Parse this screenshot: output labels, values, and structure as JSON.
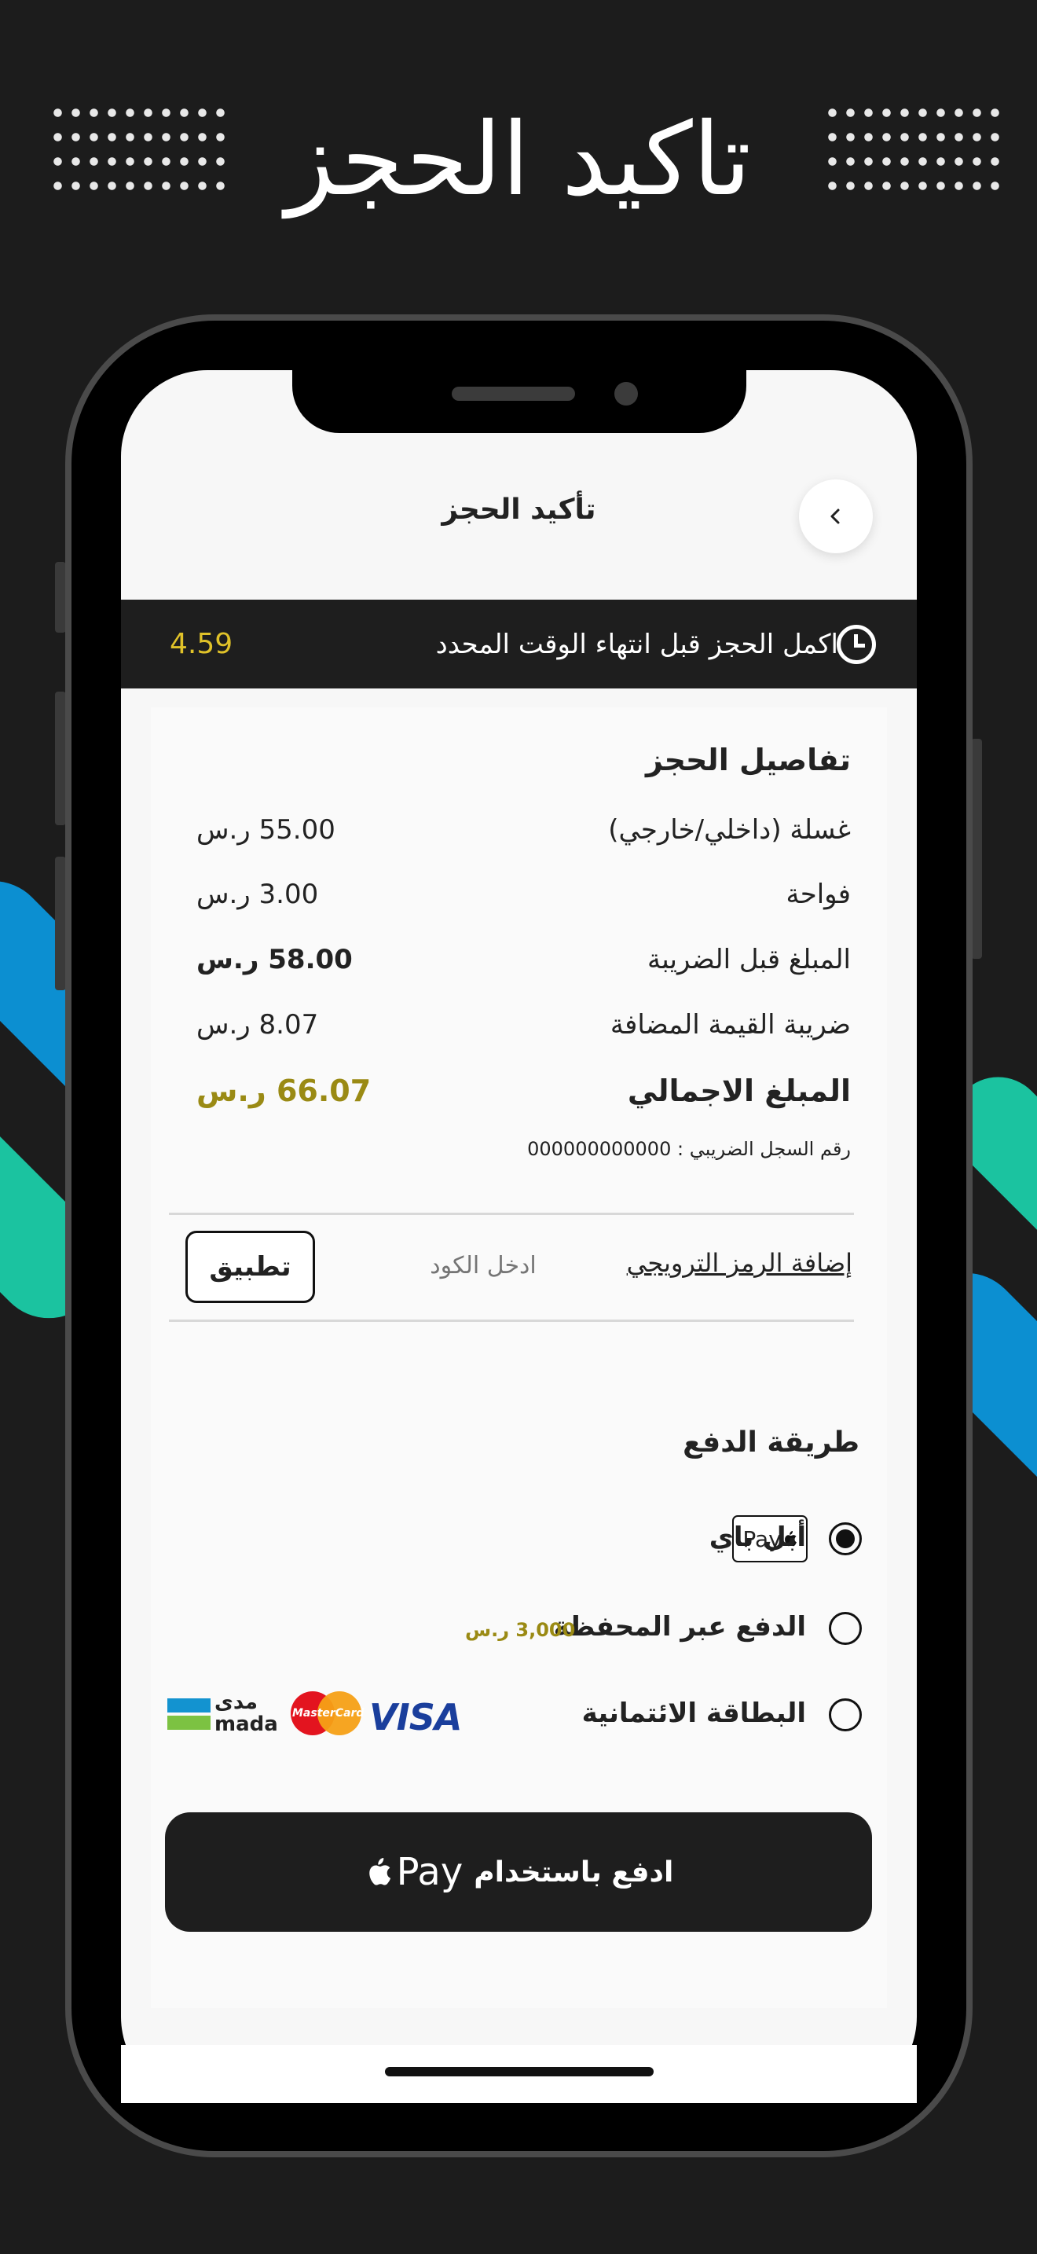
{
  "promo": {
    "title": "تاكيد الحجز"
  },
  "header": {
    "title": "تأكيد الحجز"
  },
  "timer": {
    "text": "اكمل الحجز قبل انتهاء الوقت المحدد",
    "value": "4.59"
  },
  "details": {
    "heading": "تفاصيل الحجز",
    "items": [
      {
        "label": "غسلة (داخلي/خارجي)",
        "value": "55.00 ر.س"
      },
      {
        "label": "فواحة",
        "value": "3.00 ر.س"
      },
      {
        "label": "المبلغ قبل الضريبة",
        "value": "58.00 ر.س"
      },
      {
        "label": "ضريبة القيمة المضافة",
        "value": "8.07 ر.س"
      }
    ],
    "total": {
      "label": "المبلغ الاجمالي",
      "value": "66.07 ر.س"
    },
    "tax_number": "رقم السجل الضريبي :  000000000000"
  },
  "promo_code": {
    "link_label": "إضافة الرمز الترويجي",
    "placeholder": "ادخل الكود",
    "apply_label": "تطبيق"
  },
  "payment": {
    "heading": "طريقة الدفع",
    "options": [
      {
        "label": "أبل باي",
        "badge": "Pay",
        "selected": true
      },
      {
        "label": "الدفع عبر المحفظة",
        "amount": "3,000 ر.س",
        "selected": false
      },
      {
        "label": "البطاقة الائتمانية",
        "selected": false
      }
    ],
    "card_brands": {
      "visa": "VISA",
      "mastercard": "MasterCard",
      "mada_ar": "مدى",
      "mada_en": "mada"
    },
    "button_label": "ادفع باستخدام",
    "button_pay": "Pay"
  },
  "colors": {
    "background": "#1c1c1c",
    "accent": "#9a8a14",
    "timer": "#e0c229",
    "stripe_blue": "#0c8fd1",
    "stripe_green": "#1bc3a0"
  },
  "icons": [
    "chevron-icon",
    "clock-icon",
    "apple-icon"
  ]
}
